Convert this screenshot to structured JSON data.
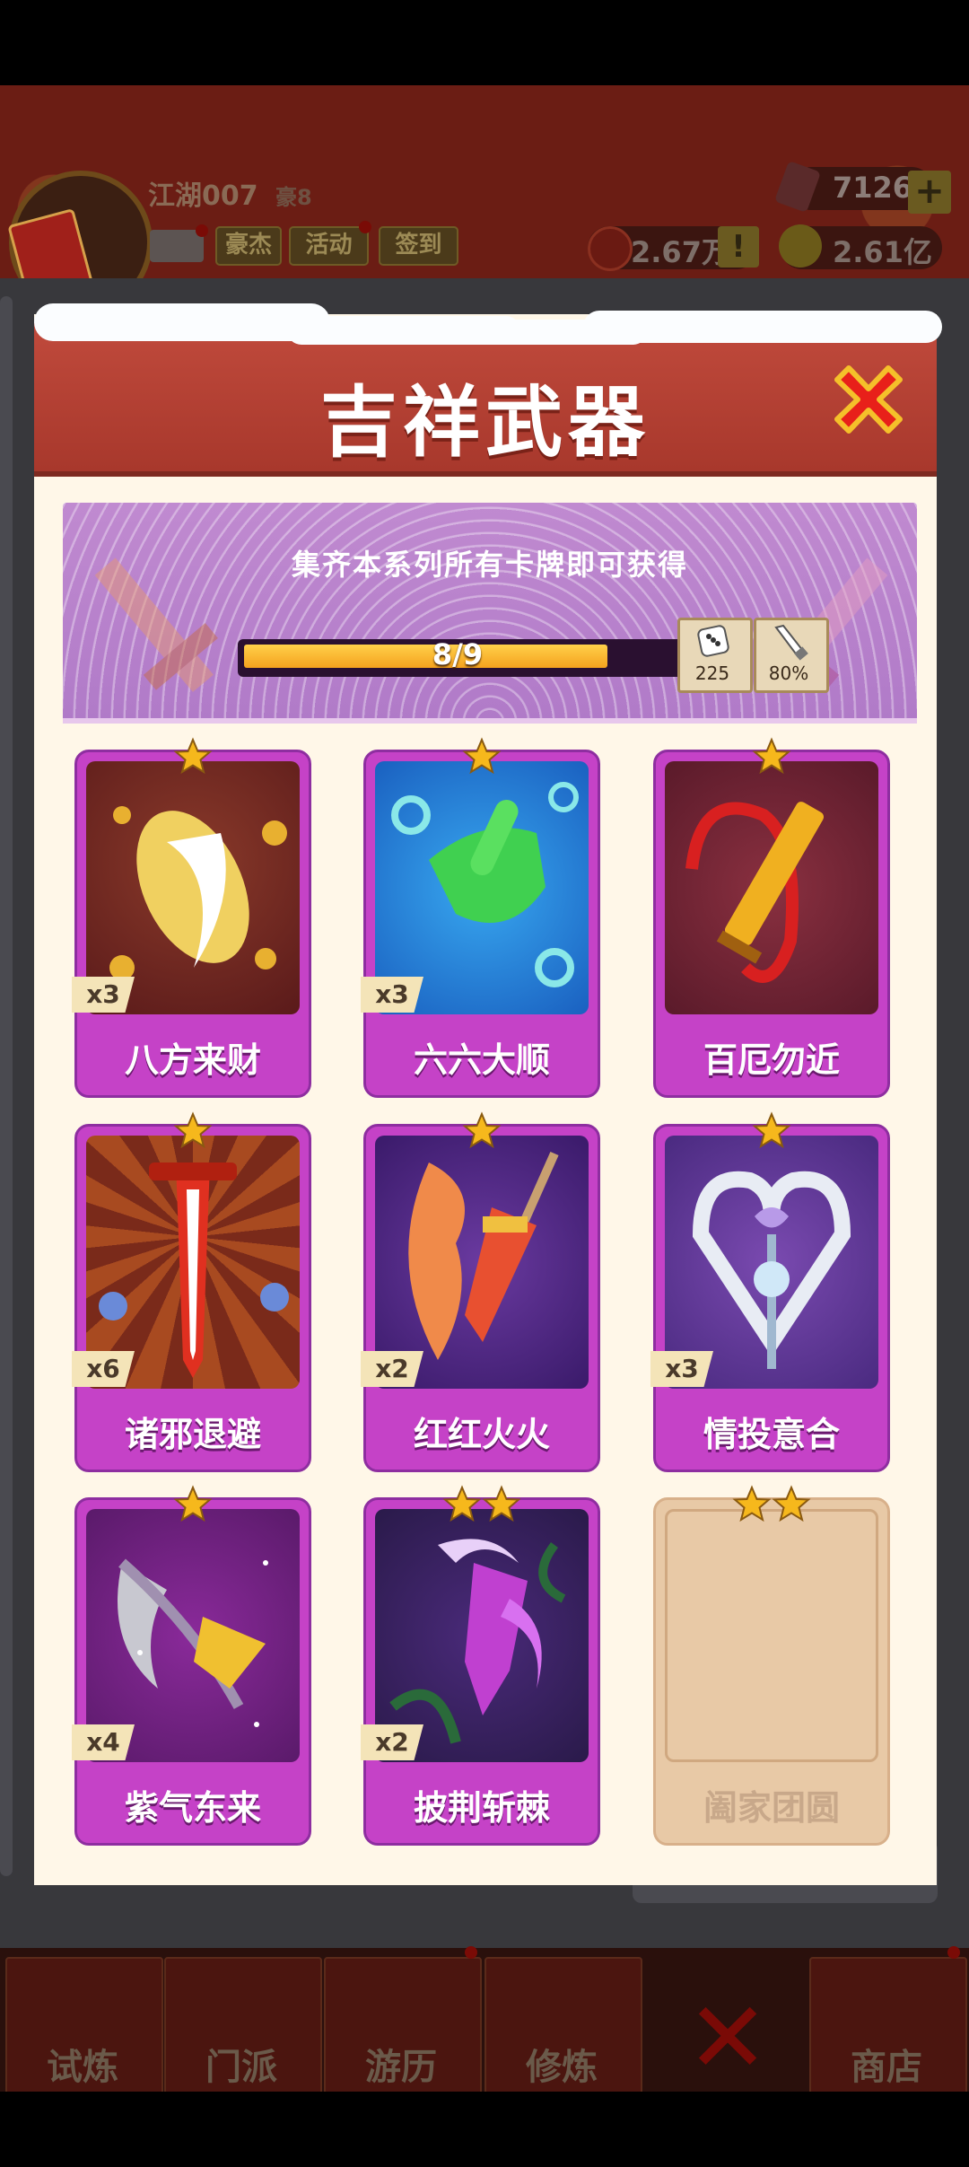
{
  "header": {
    "username": "江湖007",
    "rank": "豪8",
    "buttons": {
      "haojie": "豪杰",
      "activity": "活动",
      "signin": "签到"
    },
    "gems": "7126",
    "gem_plus": "+",
    "silver": "2.67万",
    "silver_alert": "!",
    "gold": "2.61亿"
  },
  "dialog": {
    "title": "吉祥武器",
    "banner_text": "集齐本系列所有卡牌即可获得",
    "progress": {
      "current": 8,
      "total": 9,
      "label": "8/9"
    },
    "rewards": [
      {
        "icon": "dice-icon",
        "value": "225"
      },
      {
        "icon": "sword-icon",
        "value": "80%"
      }
    ],
    "cards": [
      {
        "name": "八方来财",
        "count": "x3",
        "stars": 1,
        "collected": true
      },
      {
        "name": "六六大顺",
        "count": "x3",
        "stars": 1,
        "collected": true
      },
      {
        "name": "百厄勿近",
        "count": "",
        "stars": 1,
        "collected": true
      },
      {
        "name": "诸邪退避",
        "count": "x6",
        "stars": 1,
        "collected": true
      },
      {
        "name": "红红火火",
        "count": "x2",
        "stars": 1,
        "collected": true
      },
      {
        "name": "情投意合",
        "count": "x3",
        "stars": 1,
        "collected": true
      },
      {
        "name": "紫气东来",
        "count": "x4",
        "stars": 1,
        "collected": true
      },
      {
        "name": "披荆斩棘",
        "count": "x2",
        "stars": 2,
        "collected": true
      },
      {
        "name": "阖家团圆",
        "count": "",
        "stars": 2,
        "collected": false
      }
    ]
  },
  "nav": {
    "items": [
      "试炼",
      "门派",
      "游历",
      "修炼",
      "",
      "商店"
    ]
  },
  "colors": {
    "card": "#c542c7",
    "header": "#b03e31",
    "star": "#f6b81c",
    "progress": "#f5a21e"
  }
}
